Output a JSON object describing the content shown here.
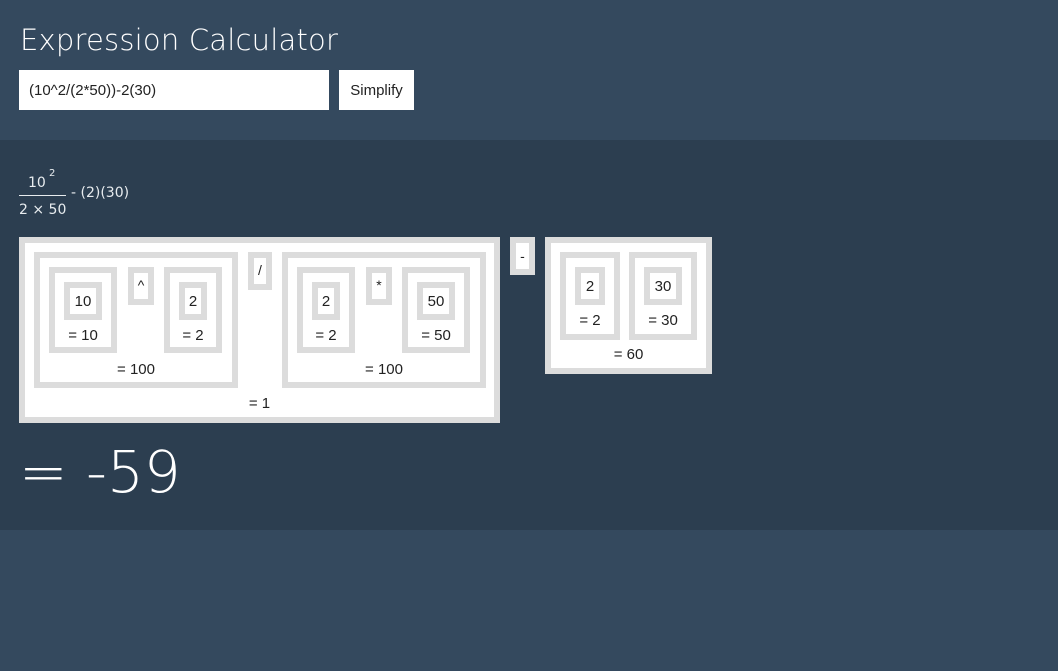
{
  "header": {
    "title": "Expression Calculator",
    "input_value": "(10^2/(2*50))-2(30)",
    "simplify_label": "Simplify"
  },
  "preview": {
    "numerator": "10",
    "exponent": "2",
    "denominator": "2 × 50",
    "rest": "- (2)(30)"
  },
  "tree": {
    "left": {
      "result": "= 1",
      "power": {
        "result": "= 100",
        "base": {
          "value": "10",
          "result": "= 10"
        },
        "operator": "^",
        "exponent": {
          "value": "2",
          "result": "= 2"
        }
      },
      "operator": "/",
      "product": {
        "result": "= 100",
        "a": {
          "value": "2",
          "result": "= 2"
        },
        "operator": "*",
        "b": {
          "value": "50",
          "result": "= 50"
        }
      }
    },
    "operator": "-",
    "right": {
      "result": "= 60",
      "a": {
        "value": "2",
        "result": "= 2"
      },
      "b": {
        "value": "30",
        "result": "= 30"
      }
    }
  },
  "final_result": "= -59"
}
